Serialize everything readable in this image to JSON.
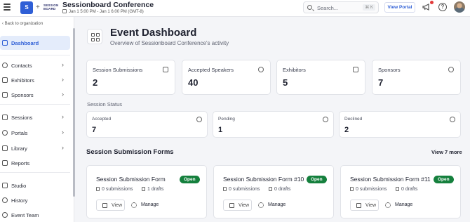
{
  "header": {
    "logo_text": "S",
    "brand_text": "SESSION BOARD",
    "event_title": "Sessionboard Conference",
    "event_date": "Jan 1 5:00 PM - Jan 1 6:00 PM (GMT-8)",
    "search_placeholder": "Search...",
    "search_shortcut": "⌘ K",
    "view_portal_label": "View Portal",
    "help_glyph": "?"
  },
  "sidebar": {
    "back_label": "Back to organization",
    "items": [
      {
        "label": "Dashboard",
        "active": true
      },
      {
        "label": "Contacts"
      },
      {
        "label": "Exhibitors"
      },
      {
        "label": "Sponsors"
      },
      {
        "label": "Sessions"
      },
      {
        "label": "Portals"
      },
      {
        "label": "Library"
      },
      {
        "label": "Reports"
      },
      {
        "label": "Studio"
      },
      {
        "label": "History"
      },
      {
        "label": "Event Team"
      }
    ]
  },
  "page": {
    "title": "Event Dashboard",
    "subtitle": "Overview of Sessionboard Conference's activity"
  },
  "stats": [
    {
      "label": "Session Submissions",
      "value": "2",
      "icon": "document-icon"
    },
    {
      "label": "Accepted Speakers",
      "value": "40",
      "icon": "microphone-icon"
    },
    {
      "label": "Exhibitors",
      "value": "5",
      "icon": "store-icon"
    },
    {
      "label": "Sponsors",
      "value": "7",
      "icon": "award-icon"
    }
  ],
  "session_status": {
    "label": "Session Status",
    "items": [
      {
        "label": "Accepted",
        "value": "7",
        "icon": "check-circle-icon"
      },
      {
        "label": "Pending",
        "value": "1",
        "icon": "clock-icon"
      },
      {
        "label": "Declined",
        "value": "2",
        "icon": "x-circle-icon"
      }
    ]
  },
  "forms": {
    "title": "Session Submission Forms",
    "view_more": "View 7 more",
    "items": [
      {
        "title": "Session Submission Form",
        "status": "Open",
        "submissions": "0 submissions",
        "drafts": "1 drafts",
        "view": "View",
        "manage": "Manage"
      },
      {
        "title": "Session Submission Form #10",
        "status": "Open",
        "submissions": "0 submissions",
        "drafts": "0 drafts",
        "view": "View",
        "manage": "Manage"
      },
      {
        "title": "Session Submission Form #11",
        "status": "Open",
        "submissions": "0 submissions",
        "drafts": "0 drafts",
        "view": "View",
        "manage": "Manage"
      }
    ]
  },
  "colors": {
    "accent": "#2f5fd6",
    "open_badge": "#15803d",
    "notification_dot": "#e23b3b"
  }
}
